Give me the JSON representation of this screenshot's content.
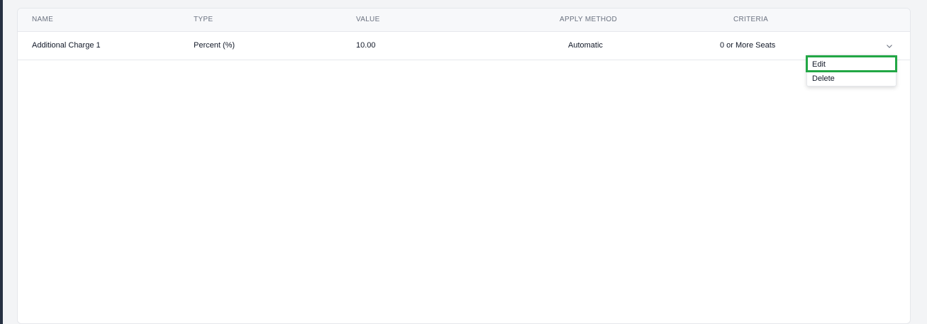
{
  "table": {
    "headers": {
      "name": "NAME",
      "type": "TYPE",
      "value": "VALUE",
      "apply_method": "APPLY METHOD",
      "criteria": "CRITERIA"
    },
    "rows": [
      {
        "name": "Additional Charge 1",
        "type": "Percent (%)",
        "value": "10.00",
        "apply_method": "Automatic",
        "criteria": "0 or More Seats"
      }
    ]
  },
  "row_menu": {
    "edit_label": "Edit",
    "delete_label": "Delete"
  },
  "colors": {
    "highlight": "#22a745",
    "sidebar": "#273142"
  },
  "icons": {
    "row_toggle": "chevron-down-icon"
  }
}
